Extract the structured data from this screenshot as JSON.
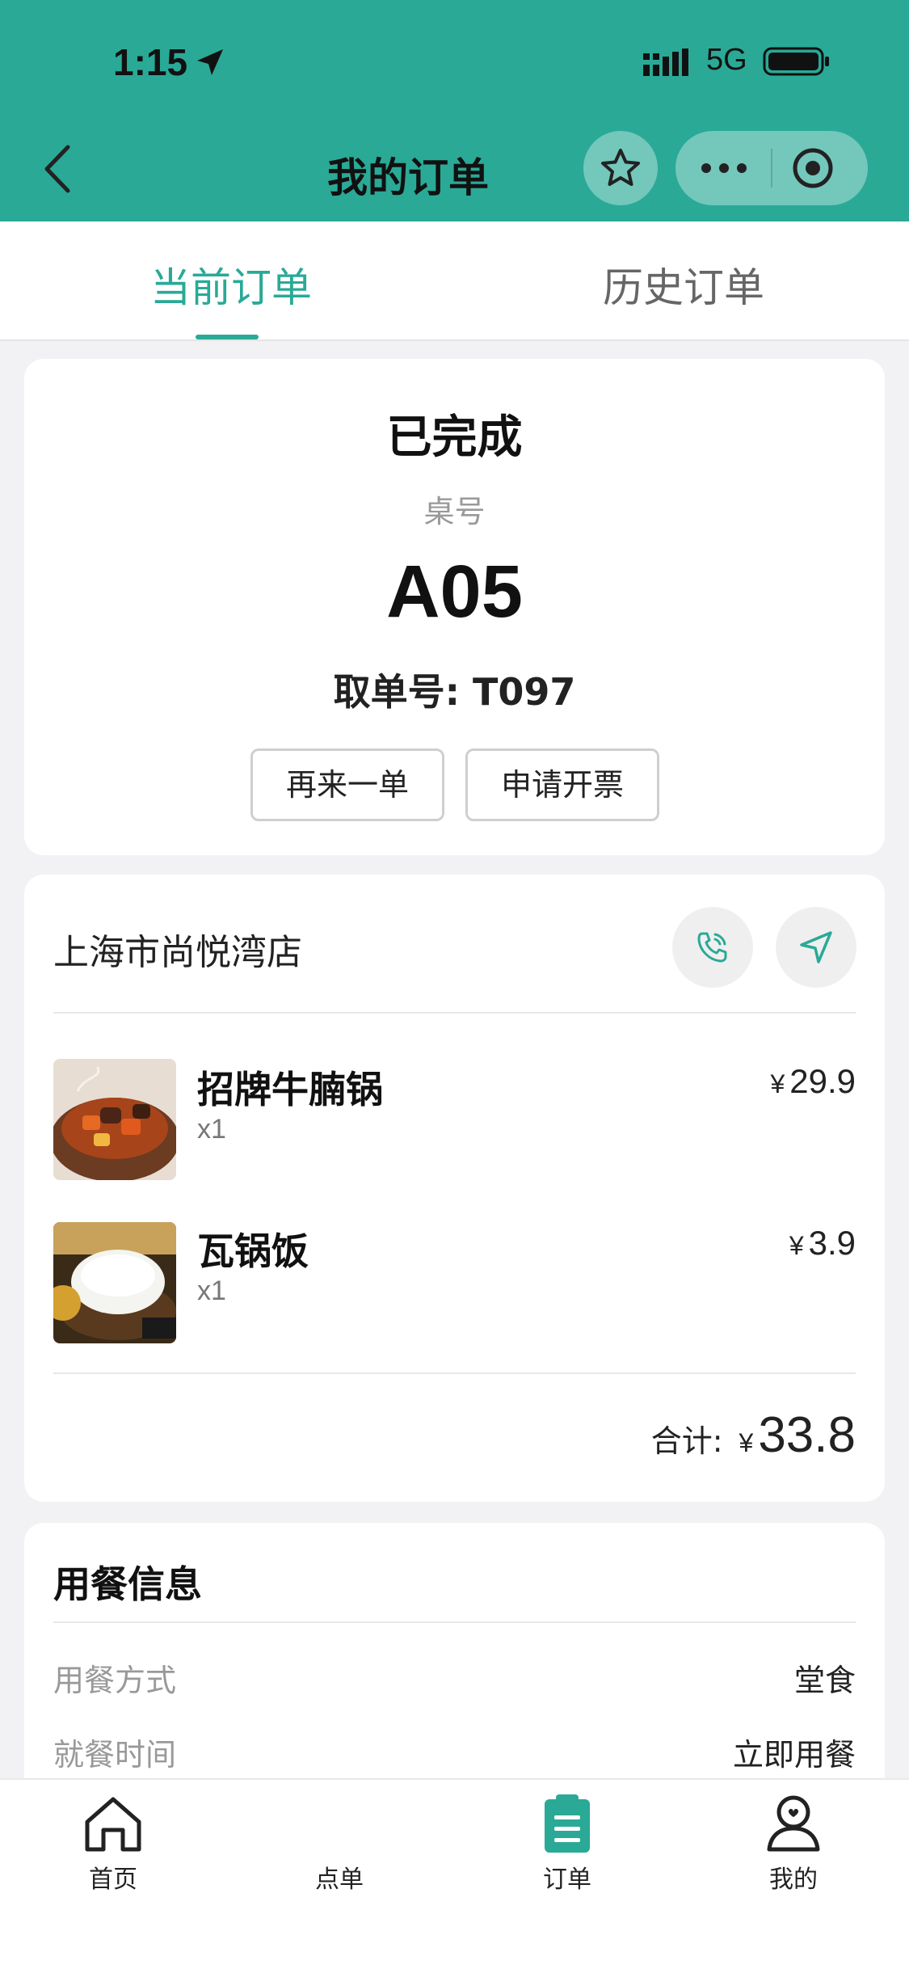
{
  "status_bar": {
    "time": "1:15",
    "network": "5G"
  },
  "nav": {
    "title": "我的订单"
  },
  "tabs": [
    {
      "label": "当前订单",
      "active": true
    },
    {
      "label": "历史订单",
      "active": false
    }
  ],
  "order_status": {
    "status": "已完成",
    "table_label": "桌号",
    "table_no": "A05",
    "pickup": "取单号: T097",
    "buttons": [
      "再来一单",
      "申请开票"
    ]
  },
  "store": {
    "name": "上海市尚悦湾店",
    "items": [
      {
        "name": "招牌牛腩锅",
        "qty": "x1",
        "currency": "¥",
        "price": "29.9"
      },
      {
        "name": "瓦锅饭",
        "qty": "x1",
        "currency": "¥",
        "price": "3.9"
      }
    ],
    "total_label": "合计:",
    "total_currency": "¥",
    "total": "33.8"
  },
  "dining_info": {
    "title": "用餐信息",
    "rows": [
      {
        "label": "用餐方式",
        "value": "堂食"
      },
      {
        "label": "就餐时间",
        "value": "立即用餐"
      }
    ]
  },
  "tabbar": [
    {
      "label": "首页",
      "icon": "home-icon"
    },
    {
      "label": "点单",
      "icon": "menu-icon"
    },
    {
      "label": "订单",
      "icon": "order-icon",
      "active": true
    },
    {
      "label": "我的",
      "icon": "profile-icon"
    }
  ],
  "colors": {
    "accent": "#2aa997"
  }
}
